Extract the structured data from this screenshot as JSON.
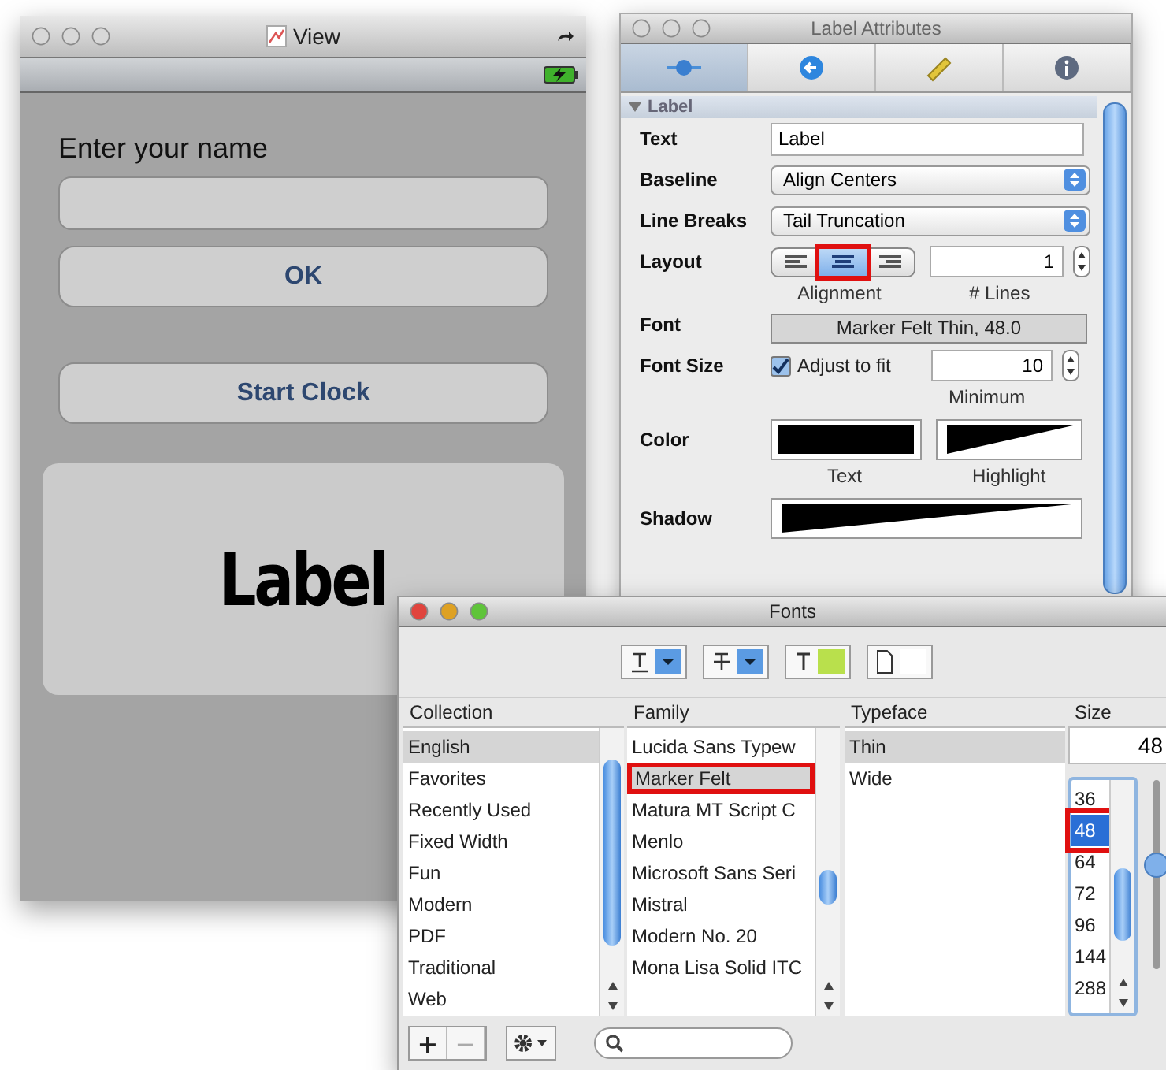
{
  "view_window": {
    "title": "View",
    "active": false,
    "prompt": "Enter your name",
    "buttons": [
      {
        "label": "OK"
      },
      {
        "label": "Start Clock"
      }
    ],
    "label_preview": "Label"
  },
  "inspector": {
    "title": "Label Attributes",
    "active": false,
    "tabs": [
      {
        "selected": true
      },
      {
        "selected": false
      },
      {
        "selected": false
      },
      {
        "selected": false
      }
    ],
    "section": {
      "title": "Label",
      "expanded": true
    },
    "text": {
      "label": "Text",
      "value": "Label"
    },
    "baseline": {
      "label": "Baseline",
      "value": "Align Centers"
    },
    "line_breaks": {
      "label": "Line Breaks",
      "value": "Tail Truncation"
    },
    "layout": {
      "label": "Layout",
      "alignments": [
        {
          "selected": false,
          "highlighted": false
        },
        {
          "selected": true,
          "highlighted": true
        },
        {
          "selected": false,
          "highlighted": false
        }
      ],
      "alignment_caption": "Alignment",
      "lines": "1",
      "lines_caption": "# Lines"
    },
    "font": {
      "label": "Font",
      "value": "Marker Felt Thin, 48.0"
    },
    "font_size": {
      "label": "Font Size",
      "adjust": {
        "label": "Adjust to fit",
        "checked": true
      },
      "minimum": "10",
      "minimum_caption": "Minimum"
    },
    "color": {
      "label": "Color",
      "text_caption": "Text",
      "highlight_caption": "Highlight"
    },
    "shadow": {
      "label": "Shadow"
    }
  },
  "fonts": {
    "title": "Fonts",
    "active": true,
    "columns": [
      "Collection",
      "Family",
      "Typeface",
      "Size"
    ],
    "collections": [
      {
        "name": "English",
        "selected": true
      },
      {
        "name": "Favorites",
        "selected": false
      },
      {
        "name": "Recently Used",
        "selected": false
      },
      {
        "name": "Fixed Width",
        "selected": false
      },
      {
        "name": "Fun",
        "selected": false
      },
      {
        "name": "Modern",
        "selected": false
      },
      {
        "name": "PDF",
        "selected": false
      },
      {
        "name": "Traditional",
        "selected": false
      },
      {
        "name": "Web",
        "selected": false
      }
    ],
    "families": [
      {
        "name": "Lucida Sans Typew",
        "selected": false,
        "highlighted": false
      },
      {
        "name": "Marker Felt",
        "selected": true,
        "highlighted": true
      },
      {
        "name": "Matura MT Script C",
        "selected": false,
        "highlighted": false
      },
      {
        "name": "Menlo",
        "selected": false,
        "highlighted": false
      },
      {
        "name": "Microsoft Sans Seri",
        "selected": false,
        "highlighted": false
      },
      {
        "name": "Mistral",
        "selected": false,
        "highlighted": false
      },
      {
        "name": "Modern No. 20",
        "selected": false,
        "highlighted": false
      },
      {
        "name": "Mona Lisa Solid ITC",
        "selected": false,
        "highlighted": false
      }
    ],
    "typefaces": [
      {
        "name": "Thin",
        "selected": true
      },
      {
        "name": "Wide",
        "selected": false
      }
    ],
    "size_value": "48",
    "sizes": [
      {
        "value": "36",
        "selected": false,
        "highlighted": false
      },
      {
        "value": "48",
        "selected": true,
        "highlighted": true
      },
      {
        "value": "64",
        "selected": false,
        "highlighted": false
      },
      {
        "value": "72",
        "selected": false,
        "highlighted": false
      },
      {
        "value": "96",
        "selected": false,
        "highlighted": false
      },
      {
        "value": "144",
        "selected": false,
        "highlighted": false
      },
      {
        "value": "288",
        "selected": false,
        "highlighted": false
      }
    ],
    "size_slider": {
      "level": 0.55
    },
    "add_button": "+",
    "remove_button": "−"
  }
}
